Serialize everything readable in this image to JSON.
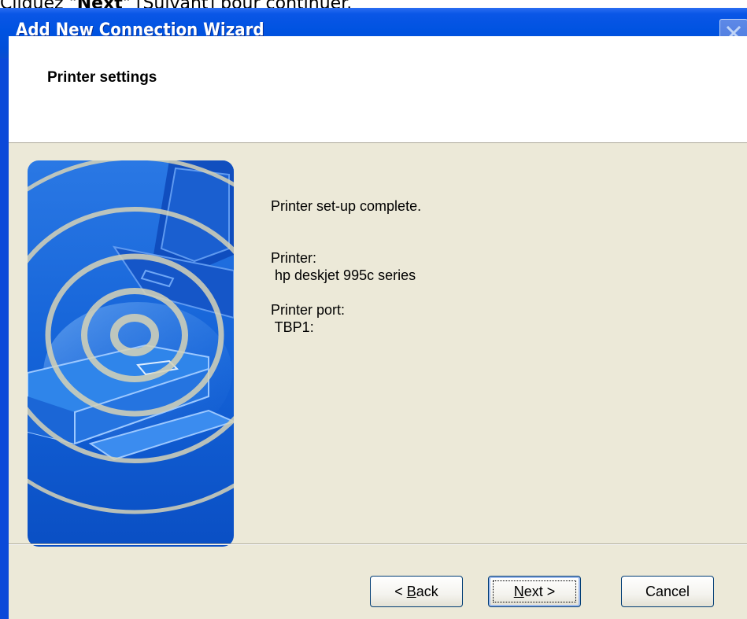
{
  "instruction": {
    "prefix": "Cliquez ",
    "key_first": "N",
    "key_rest": "ext",
    "suffix": " [Suivant] pour continuer."
  },
  "window": {
    "title": "Add New Connection Wizard"
  },
  "header": {
    "title": "Printer settings"
  },
  "content": {
    "status": "Printer set-up complete.",
    "printer_label": "Printer:",
    "printer_value": " hp deskjet 995c series",
    "port_label": "Printer port:",
    "port_value": " TBP1:"
  },
  "buttons": {
    "back": {
      "prefix": "< ",
      "accel": "B",
      "rest": "ack"
    },
    "next": {
      "accel": "N",
      "rest": "ext >"
    },
    "cancel": "Cancel"
  },
  "colors": {
    "titlebar": "#0053e1",
    "dialog_bg": "#ece9d8",
    "art_blue": "#1a63d6"
  }
}
